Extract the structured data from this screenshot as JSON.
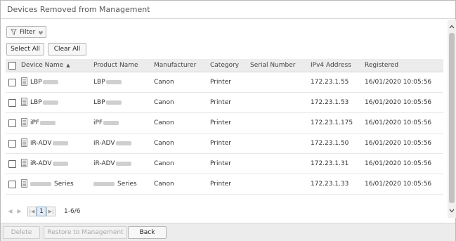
{
  "dialog": {
    "title": "Devices Removed from Management"
  },
  "toolbar": {
    "filter_label": "Filter",
    "select_all_label": "Select All",
    "clear_all_label": "Clear All"
  },
  "table": {
    "columns": {
      "device_name": "Device Name",
      "product_name": "Product Name",
      "manufacturer": "Manufacturer",
      "category": "Category",
      "serial_number": "Serial Number",
      "ipv4": "IPv4 Address",
      "registered": "Registered"
    },
    "sort": {
      "column": "device_name",
      "direction": "ascending"
    },
    "rows": [
      {
        "device": "LBP",
        "product": "LBP",
        "device_suffix": "",
        "product_suffix": "",
        "manufacturer": "Canon",
        "category": "Printer",
        "serial": "",
        "ip": "172.23.1.55",
        "registered": "16/01/2020 10:05:56"
      },
      {
        "device": "LBP",
        "product": "LBP",
        "device_suffix": "",
        "product_suffix": "",
        "manufacturer": "Canon",
        "category": "Printer",
        "serial": "",
        "ip": "172.23.1.53",
        "registered": "16/01/2020 10:05:56"
      },
      {
        "device": "iPF",
        "product": "iPF",
        "device_suffix": "",
        "product_suffix": "",
        "manufacturer": "Canon",
        "category": "Printer",
        "serial": "",
        "ip": "172.23.1.175",
        "registered": "16/01/2020 10:05:56"
      },
      {
        "device": "iR-ADV",
        "product": "iR-ADV",
        "device_suffix": "",
        "product_suffix": "",
        "manufacturer": "Canon",
        "category": "Printer",
        "serial": "",
        "ip": "172.23.1.50",
        "registered": "16/01/2020 10:05:56"
      },
      {
        "device": "iR-ADV",
        "product": "iR-ADV",
        "device_suffix": "",
        "product_suffix": "",
        "manufacturer": "Canon",
        "category": "Printer",
        "serial": "",
        "ip": "172.23.1.31",
        "registered": "16/01/2020 10:05:56"
      },
      {
        "device": "",
        "product": "",
        "device_suffix": "Series",
        "product_suffix": "Series",
        "manufacturer": "Canon",
        "category": "Printer",
        "serial": "",
        "ip": "172.23.1.33",
        "registered": "16/01/2020 10:05:56"
      }
    ]
  },
  "pager": {
    "current_page": "1",
    "range_text": "1-6/6"
  },
  "footer": {
    "delete_label": "Delete",
    "restore_label": "Restore to Management",
    "back_label": "Back"
  },
  "icons": {
    "filter": "filter-icon",
    "chevron": "chevron-down-icon",
    "device": "printer-device-icon",
    "sort": "sort-up-icon"
  }
}
